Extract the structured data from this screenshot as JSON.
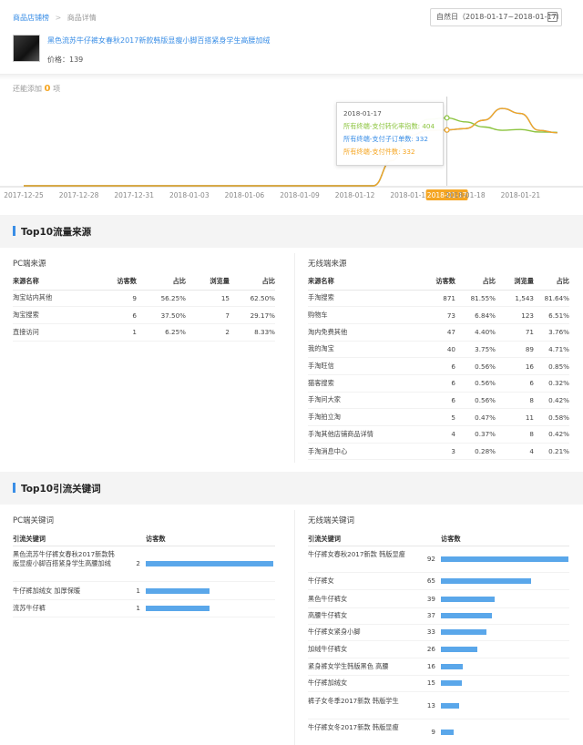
{
  "breadcrumb": {
    "parent": "商品店铺榜",
    "separator": ">",
    "current": "商品详情"
  },
  "date_range": "自然日（2018-01-17~2018-01-17）",
  "product": {
    "title": "黑色流苏牛仔裤女春秋2017新款韩版显瘦小脚百搭紧身学生高腰加绒",
    "price_label": "价格：",
    "price": "139"
  },
  "add_tip": {
    "prefix": "还能添加",
    "count": "0",
    "suffix": "项"
  },
  "colors": {
    "accent": "#3a8ee6",
    "orange": "#f5a623",
    "green": "#8cc43f",
    "bar": "#5aa7ea"
  },
  "chart_data": {
    "type": "line",
    "x": [
      "2017-12-25",
      "2017-12-26",
      "2017-12-27",
      "2017-12-28",
      "2017-12-29",
      "2017-12-30",
      "2017-12-31",
      "2018-01-01",
      "2018-01-02",
      "2018-01-03",
      "2018-01-04",
      "2018-01-05",
      "2018-01-06",
      "2018-01-07",
      "2018-01-08",
      "2018-01-09",
      "2018-01-10",
      "2018-01-11",
      "2018-01-12",
      "2018-01-13",
      "2018-01-14",
      "2018-01-15",
      "2018-01-16",
      "2018-01-17",
      "2018-01-18",
      "2018-01-19",
      "2018-01-20",
      "2018-01-21",
      "2018-01-22",
      "2018-01-23"
    ],
    "tick_labels": [
      "2017-12-25",
      "2017-12-28",
      "2017-12-31",
      "2018-01-03",
      "2018-01-06",
      "2018-01-09",
      "2018-01-12",
      "2018-01-15",
      "2018-01-17",
      "2018-01-18",
      "2018-01-21"
    ],
    "highlight_label": "2018-01-17",
    "series": [
      {
        "name": "所有终端-支付转化率指数",
        "color": "#8cc43f",
        "values": [
          0,
          0,
          0,
          0,
          0,
          0,
          0,
          0,
          0,
          0,
          0,
          0,
          0,
          0,
          0,
          0,
          0,
          0,
          0,
          0,
          150,
          330,
          395,
          404,
          380,
          350,
          330,
          335,
          320,
          318
        ]
      },
      {
        "name": "所有终端-支付子订单数",
        "color": "#3a8ee6",
        "values": [
          0,
          0,
          0,
          0,
          0,
          0,
          0,
          0,
          0,
          0,
          0,
          0,
          0,
          0,
          0,
          0,
          0,
          0,
          0,
          0,
          150,
          300,
          330,
          332,
          340,
          390,
          460,
          430,
          330,
          315
        ]
      },
      {
        "name": "所有终端-支付件数",
        "color": "#f5a623",
        "values": [
          0,
          0,
          0,
          0,
          0,
          0,
          0,
          0,
          0,
          0,
          0,
          0,
          0,
          0,
          0,
          0,
          0,
          0,
          0,
          0,
          150,
          300,
          330,
          332,
          340,
          390,
          460,
          430,
          330,
          315
        ]
      }
    ],
    "ylim": [
      0,
      520
    ],
    "tooltip": {
      "date": "2018-01-17",
      "lines": [
        "所有终端-支付转化率指数: 404",
        "所有终端-支付子订单数: 332",
        "所有终端-支付件数: 332"
      ]
    }
  },
  "traffic": {
    "title": "Top10流量来源",
    "pc": {
      "title": "PC端来源",
      "headers": [
        "来源名称",
        "访客数",
        "占比",
        "浏览量",
        "占比"
      ],
      "rows": [
        [
          "淘宝站内其他",
          "9",
          "56.25%",
          "15",
          "62.50%"
        ],
        [
          "淘宝搜索",
          "6",
          "37.50%",
          "7",
          "29.17%"
        ],
        [
          "直接访问",
          "1",
          "6.25%",
          "2",
          "8.33%"
        ]
      ]
    },
    "mobile": {
      "title": "无线端来源",
      "headers": [
        "来源名称",
        "访客数",
        "占比",
        "浏览量",
        "占比"
      ],
      "rows": [
        [
          "手淘搜索",
          "871",
          "81.55%",
          "1,543",
          "81.64%"
        ],
        [
          "购物车",
          "73",
          "6.84%",
          "123",
          "6.51%"
        ],
        [
          "淘内免费其他",
          "47",
          "4.40%",
          "71",
          "3.76%"
        ],
        [
          "我的淘宝",
          "40",
          "3.75%",
          "89",
          "4.71%"
        ],
        [
          "手淘旺信",
          "6",
          "0.56%",
          "16",
          "0.85%"
        ],
        [
          "猫客搜索",
          "6",
          "0.56%",
          "6",
          "0.32%"
        ],
        [
          "手淘问大家",
          "6",
          "0.56%",
          "8",
          "0.42%"
        ],
        [
          "手淘拍立淘",
          "5",
          "0.47%",
          "11",
          "0.58%"
        ],
        [
          "手淘其他店铺商品详情",
          "4",
          "0.37%",
          "8",
          "0.42%"
        ],
        [
          "手淘消息中心",
          "3",
          "0.28%",
          "4",
          "0.21%"
        ]
      ]
    }
  },
  "keywords": {
    "title": "Top10引流关键词",
    "pc": {
      "title": "PC端关键词",
      "headers": [
        "引流关键词",
        "访客数"
      ],
      "rows": [
        {
          "keyword": "黑色流苏牛仔裤女春秋2017新款韩版显瘦小脚百搭紧身学生高腰加绒",
          "visitors": 2
        },
        {
          "keyword": "牛仔裤加绒女 加厚保暖",
          "visitors": 1
        },
        {
          "keyword": "流苏牛仔裤",
          "visitors": 1
        }
      ]
    },
    "mobile": {
      "title": "无线端关键词",
      "headers": [
        "引流关键词",
        "访客数"
      ],
      "rows": [
        {
          "keyword": "牛仔裤女春秋2017新款 韩版显瘦",
          "visitors": 92
        },
        {
          "keyword": "牛仔裤女",
          "visitors": 65
        },
        {
          "keyword": "黑色牛仔裤女",
          "visitors": 39
        },
        {
          "keyword": "高腰牛仔裤女",
          "visitors": 37
        },
        {
          "keyword": "牛仔裤女紧身小脚",
          "visitors": 33
        },
        {
          "keyword": "加绒牛仔裤女",
          "visitors": 26
        },
        {
          "keyword": "紧身裤女学生韩版黑色 高腰",
          "visitors": 16
        },
        {
          "keyword": "牛仔裤加绒女",
          "visitors": 15
        },
        {
          "keyword": "裤子女冬季2017新款 韩版学生",
          "visitors": 13
        },
        {
          "keyword": "牛仔裤女冬2017新款 韩版显瘦",
          "visitors": 9
        }
      ]
    }
  }
}
